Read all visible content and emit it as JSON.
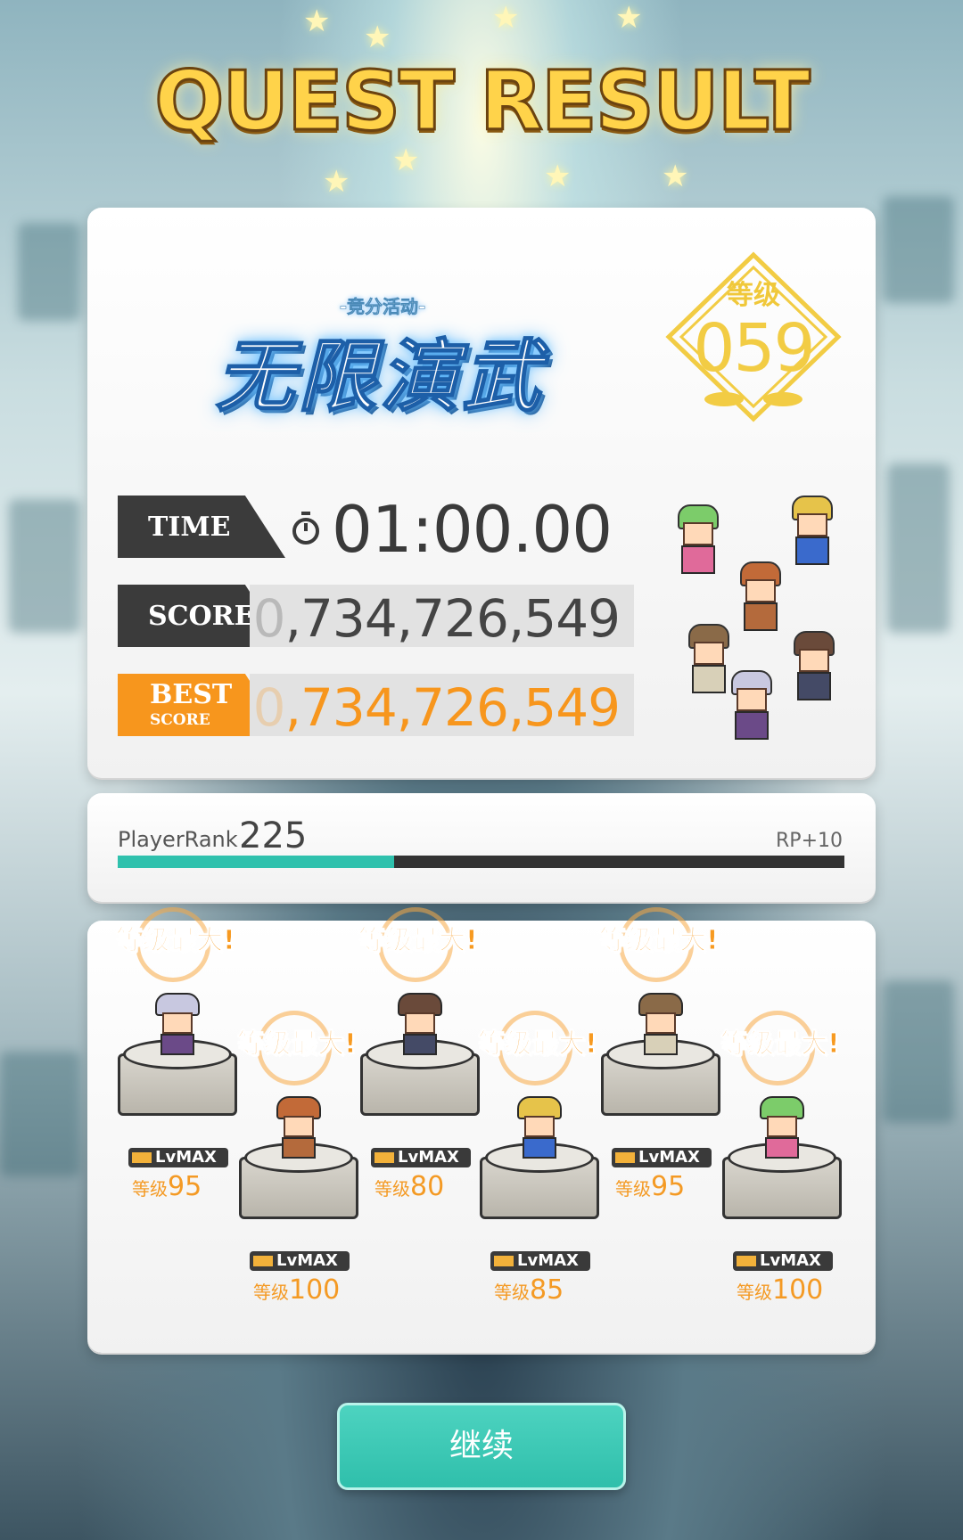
{
  "header": {
    "title": "QUEST RESULT"
  },
  "event": {
    "subtitle": "-竞分活动-",
    "name": "无限演武"
  },
  "level_badge": {
    "label": "等级",
    "value": "059"
  },
  "stats": {
    "time_label": "TIME",
    "time_value": "01:00.00",
    "score_label": "SCORE",
    "score_lead": "0",
    "score_value": ",734,726,549",
    "best_label_1": "BEST",
    "best_label_2": "SCORE",
    "best_lead": "0",
    "best_value": ",734,726,549"
  },
  "player_rank": {
    "label": "PlayerRank",
    "value": "225",
    "rp": "RP+10",
    "progress": 0.38
  },
  "characters": [
    {
      "max_text": "等级最大!",
      "lvmax": "LvMAX",
      "lv_key": "等级",
      "level": "95",
      "hair": "#c8c8e0",
      "body": "#6b4a88"
    },
    {
      "max_text": "等级最大!",
      "lvmax": "LvMAX",
      "lv_key": "等级",
      "level": "100",
      "hair": "#c26a38",
      "body": "#b46a3c"
    },
    {
      "max_text": "等级最大!",
      "lvmax": "LvMAX",
      "lv_key": "等级",
      "level": "80",
      "hair": "#6a4a3a",
      "body": "#444a66"
    },
    {
      "max_text": "等级最大!",
      "lvmax": "LvMAX",
      "lv_key": "等级",
      "level": "85",
      "hair": "#e6c34a",
      "body": "#3a6acc"
    },
    {
      "max_text": "等级最大!",
      "lvmax": "LvMAX",
      "lv_key": "等级",
      "level": "95",
      "hair": "#8a6a48",
      "body": "#d8d0b8"
    },
    {
      "max_text": "等级最大!",
      "lvmax": "LvMAX",
      "lv_key": "等级",
      "level": "100",
      "hair": "#7ccc6a",
      "body": "#e06a9a"
    }
  ],
  "continue_button": {
    "label": "继续"
  },
  "colors": {
    "accent": "#f7961d",
    "teal": "#2fc1ad",
    "dark": "#3b3b3b"
  }
}
